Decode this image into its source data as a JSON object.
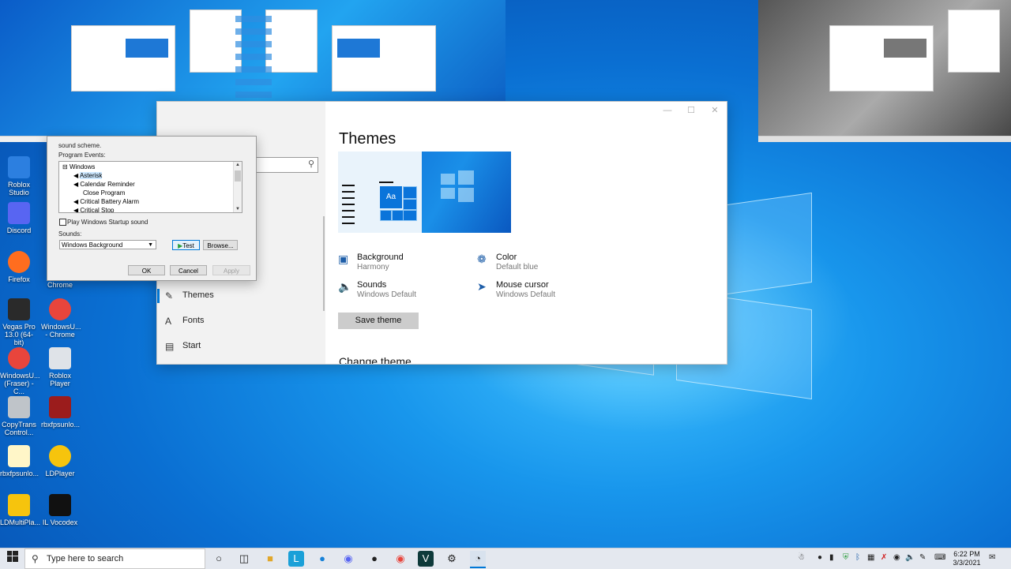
{
  "desktop_icons": [
    {
      "label": "Roblox Studio",
      "color": "#2c7fe0"
    },
    {
      "label": "Discord",
      "color": "#5865f2"
    },
    {
      "label": "Firefox",
      "color": "#ff6d1f"
    },
    {
      "label": "Vegas Pro 13.0 (64-bit)",
      "color": "#2a2a2a"
    },
    {
      "label": "WindowsU... - Chrome",
      "color": "#e8453c"
    },
    {
      "label": "WindowsU... (Fraser) - C...",
      "color": "#e8453c"
    },
    {
      "label": "Roblox Player",
      "color": "#dfe3e8"
    },
    {
      "label": "CopyTrans Control...",
      "color": "#bfc4c9"
    },
    {
      "label": "rbxfpsunlo...",
      "color": "#9b1c1c"
    },
    {
      "label": "rbxfpsunlo...",
      "color": "#fff6c8"
    },
    {
      "label": "LDPlayer",
      "color": "#f6c40d"
    },
    {
      "label": "LDMultiPla...",
      "color": "#f6c40d"
    },
    {
      "label": "IL Vocodex",
      "color": "#111111"
    },
    {
      "label": "Chrome",
      "color": "#e8453c"
    }
  ],
  "settings": {
    "page_title": "Themes",
    "nav": [
      {
        "label": "Themes",
        "icon": "brush-icon"
      },
      {
        "label": "Fonts",
        "icon": "font-icon"
      },
      {
        "label": "Start",
        "icon": "start-icon"
      }
    ],
    "preview_tile_text": "Aa",
    "properties": [
      {
        "title": "Background",
        "value": "Harmony",
        "icon": "image-icon"
      },
      {
        "title": "Color",
        "value": "Default blue",
        "icon": "palette-icon"
      },
      {
        "title": "Sounds",
        "value": "Windows Default",
        "icon": "speaker-icon"
      },
      {
        "title": "Mouse cursor",
        "value": "Windows Default",
        "icon": "cursor-icon"
      }
    ],
    "save_theme_label": "Save theme",
    "change_theme_heading": "Change theme"
  },
  "sound_dialog": {
    "intro_text": "sound scheme.",
    "program_events_label": "Program Events:",
    "events": [
      "Windows",
      "Asterisk",
      "Calendar Reminder",
      "Close Program",
      "Critical Battery Alarm",
      "Critical Stop"
    ],
    "selected_event": "Asterisk",
    "startup_sound_label": "Play Windows Startup sound",
    "sounds_label": "Sounds:",
    "sound_selected": "Windows Background",
    "test_label": "Test",
    "browse_label": "Browse...",
    "ok_label": "OK",
    "cancel_label": "Cancel",
    "apply_label": "Apply"
  },
  "taskbar": {
    "search_placeholder": "Type here to search",
    "time": "6:22 PM",
    "date": "3/3/2021"
  },
  "colors": {
    "accent": "#0078d7",
    "desktop_blue": "#1896ec"
  }
}
